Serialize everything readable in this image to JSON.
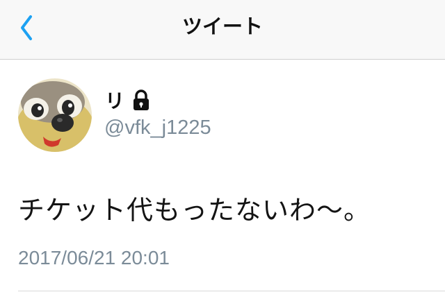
{
  "header": {
    "title": "ツイート",
    "back_icon": "chevron-left-icon",
    "accent_color": "#1da1f2"
  },
  "tweet": {
    "display_name": "リ",
    "protected_icon": "lock-icon",
    "handle": "@vfk_j1225",
    "text": "チケット代もったないわ〜。",
    "timestamp": "2017/06/21 20:01"
  }
}
